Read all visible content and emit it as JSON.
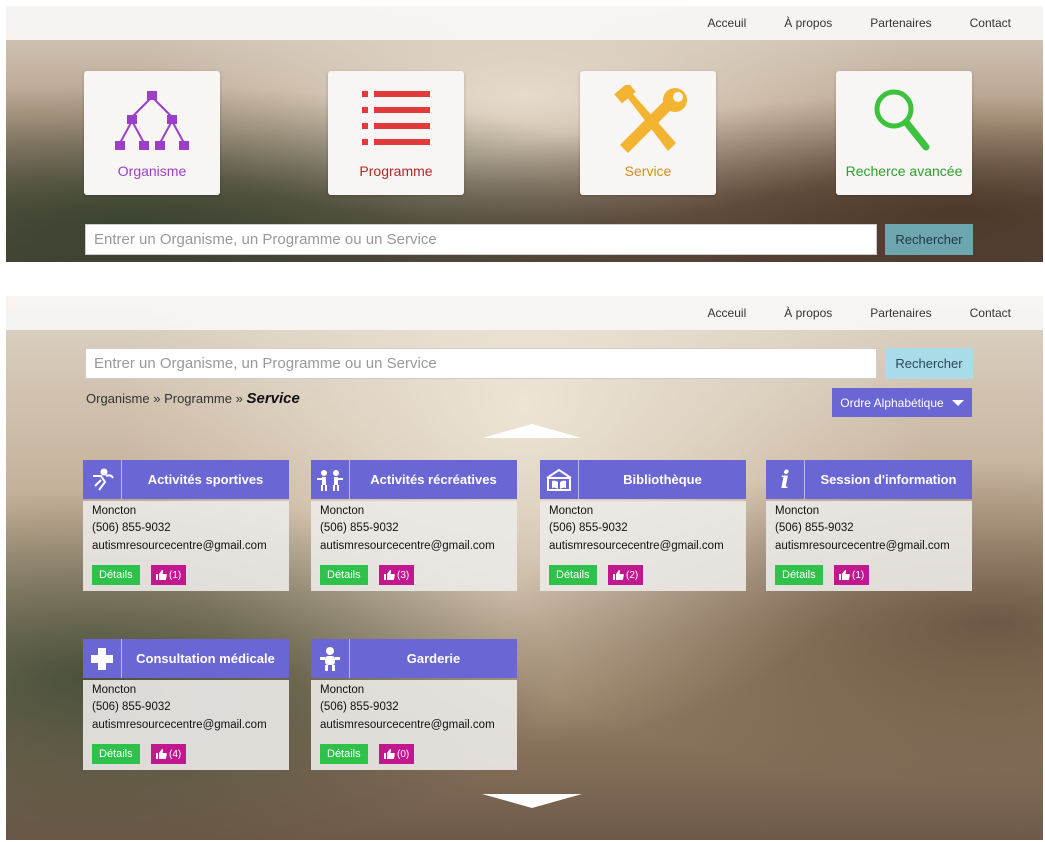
{
  "nav": [
    "Acceuil",
    "À propos",
    "Partenaires",
    "Contact"
  ],
  "home": {
    "categories": [
      {
        "label": "Organisme",
        "icon": "org-chart-icon",
        "color": "#9b3fc8"
      },
      {
        "label": "Programme",
        "icon": "list-icon",
        "color": "#e23a3a"
      },
      {
        "label": "Service",
        "icon": "tools-icon",
        "color": "#f2b431"
      },
      {
        "label": "Recherce avancée",
        "icon": "magnifier-icon",
        "color": "#3cc23c"
      }
    ],
    "search": {
      "placeholder": "Entrer un Organisme, un Programme ou un Service",
      "button": "Rechercher"
    }
  },
  "results": {
    "search": {
      "placeholder": "Entrer un Organisme, un Programme ou un Service",
      "button": "Rechercher"
    },
    "breadcrumb": {
      "level1": "Organisme",
      "sep": "»",
      "level2": "Programme",
      "current": "Service"
    },
    "sort": "Ordre Alphabétique",
    "details_label": "Détails",
    "services": [
      {
        "title": "Activités sportives",
        "icon": "sport-icon",
        "city": "Moncton",
        "phone": "(506) 855-9032",
        "email": "autismresourcecentre@gmail.com",
        "likes": "(1)"
      },
      {
        "title": "Activités récréatives",
        "icon": "recreation-icon",
        "city": "Moncton",
        "phone": "(506) 855-9032",
        "email": "autismresourcecentre@gmail.com",
        "likes": "(3)"
      },
      {
        "title": "Bibliothèque",
        "icon": "library-icon",
        "city": "Moncton",
        "phone": "(506) 855-9032",
        "email": "autismresourcecentre@gmail.com",
        "likes": "(2)"
      },
      {
        "title": "Session d'information",
        "icon": "info-icon",
        "city": "Moncton",
        "phone": "(506) 855-9032",
        "email": "autismresourcecentre@gmail.com",
        "likes": "(1)"
      },
      {
        "title": "Consultation médicale",
        "icon": "medical-cross-icon",
        "city": "Moncton",
        "phone": "(506) 855-9032",
        "email": "autismresourcecentre@gmail.com",
        "likes": "(4)"
      },
      {
        "title": "Garderie",
        "icon": "baby-icon",
        "city": "Moncton",
        "phone": "(506) 855-9032",
        "email": "autismresourcecentre@gmail.com",
        "likes": "(0)"
      }
    ]
  },
  "colors": {
    "accent": "#6a66d4",
    "details": "#2ec24a",
    "like": "#c2178f",
    "search_btn_home": "#6ea6b0",
    "search_btn_results": "#a9dbe8"
  }
}
